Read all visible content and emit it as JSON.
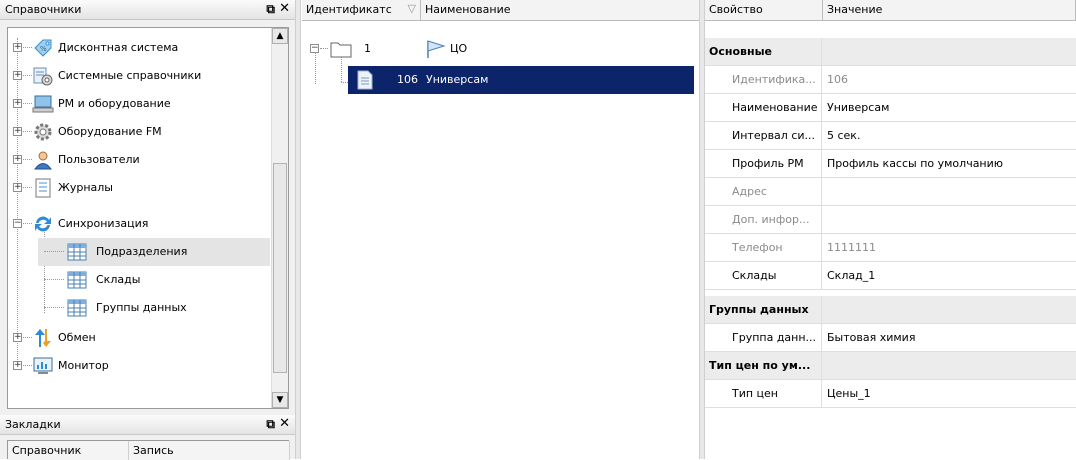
{
  "left_panel": {
    "title": "Справочники",
    "tree": [
      {
        "label": "Дисконтная система",
        "icon": "discount-icon"
      },
      {
        "label": "Системные справочники",
        "icon": "system-catalogs-icon"
      },
      {
        "label": "РМ и оборудование",
        "icon": "workstation-icon"
      },
      {
        "label": "Оборудование FM",
        "icon": "gear-icon"
      },
      {
        "label": "Пользователи",
        "icon": "user-icon"
      },
      {
        "label": "Журналы",
        "icon": "journal-icon"
      },
      {
        "label": "Синхронизация",
        "icon": "sync-icon"
      },
      {
        "label": "Подразделения",
        "icon": "table-icon"
      },
      {
        "label": "Склады",
        "icon": "table-icon"
      },
      {
        "label": "Группы данных",
        "icon": "table-icon"
      },
      {
        "label": "Обмен",
        "icon": "exchange-icon"
      },
      {
        "label": "Монитор",
        "icon": "monitor-icon"
      }
    ]
  },
  "bookmarks_panel": {
    "title": "Закладки",
    "columns": [
      "Справочник",
      "Запись"
    ]
  },
  "grid": {
    "columns": [
      "Идентификатс",
      "Наименование"
    ],
    "rows": [
      {
        "id": "1",
        "name": "ЦО"
      },
      {
        "id": "106",
        "name": "Универсам"
      }
    ]
  },
  "properties": {
    "columns": [
      "Свойство",
      "Значение"
    ],
    "rows": [
      {
        "type": "category",
        "key": "Основные",
        "value": ""
      },
      {
        "type": "item",
        "key": "Идентифика...",
        "value": "106",
        "dim": true
      },
      {
        "type": "item",
        "key": "Наименование",
        "value": "Универсам"
      },
      {
        "type": "item",
        "key": "Интервал си...",
        "value": "5 сек."
      },
      {
        "type": "item",
        "key": "Профиль РМ",
        "value": "Профиль кассы по умолчанию"
      },
      {
        "type": "item",
        "key": "Адрес",
        "value": "",
        "dim": true
      },
      {
        "type": "item",
        "key": "Доп. инфор...",
        "value": "",
        "dim": true
      },
      {
        "type": "item",
        "key": "Телефон",
        "value": "1111111",
        "dim": true
      },
      {
        "type": "item",
        "key": "Склады",
        "value": "Склад_1"
      },
      {
        "type": "category",
        "key": "Группы данных",
        "value": ""
      },
      {
        "type": "item",
        "key": "Группа данн...",
        "value": "Бытовая химия"
      },
      {
        "type": "category",
        "key": "Тип цен по ум...",
        "value": ""
      },
      {
        "type": "item",
        "key": "Тип цен",
        "value": "Цены_1"
      }
    ]
  },
  "colors": {
    "selection": "#0b246a",
    "category_bg": "#ececec",
    "accent": "#1e88d8"
  }
}
